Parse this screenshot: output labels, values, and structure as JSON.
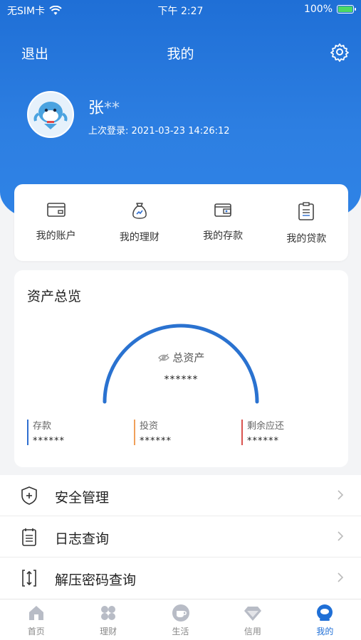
{
  "status_bar": {
    "carrier": "无SIM卡",
    "time": "下午 2:27",
    "battery": "100%"
  },
  "nav": {
    "logout": "退出",
    "title": "我的"
  },
  "profile": {
    "name": "张",
    "name_mask": "**",
    "last_login": "上次登录: 2021-03-23 14:26:12"
  },
  "quick_actions": [
    {
      "label": "我的账户",
      "icon": "card-icon"
    },
    {
      "label": "我的理财",
      "icon": "money-bag-icon"
    },
    {
      "label": "我的存款",
      "icon": "wallet-icon"
    },
    {
      "label": "我的贷款",
      "icon": "clipboard-icon"
    }
  ],
  "assets": {
    "title": "资产总览",
    "total_label": "总资产",
    "total_value": "******",
    "stats": [
      {
        "label": "存款",
        "value": "******",
        "color": "#2f6fd0"
      },
      {
        "label": "投资",
        "value": "******",
        "color": "#f0a05a"
      },
      {
        "label": "剩余应还",
        "value": "******",
        "color": "#d9534f"
      }
    ]
  },
  "menu": [
    {
      "label": "安全管理",
      "icon": "shield-plus-icon"
    },
    {
      "label": "日志查询",
      "icon": "log-list-icon"
    },
    {
      "label": "解压密码查询",
      "icon": "unzip-icon"
    }
  ],
  "tabbar": [
    {
      "label": "首页",
      "icon": "home-icon",
      "active": false
    },
    {
      "label": "理财",
      "icon": "grid-icon",
      "active": false
    },
    {
      "label": "生活",
      "icon": "coffee-icon",
      "active": false
    },
    {
      "label": "信用",
      "icon": "diamond-icon",
      "active": false
    },
    {
      "label": "我的",
      "icon": "person-icon",
      "active": true
    }
  ],
  "colors": {
    "primary": "#1f6fd6",
    "gauge": "#2a72d0"
  }
}
